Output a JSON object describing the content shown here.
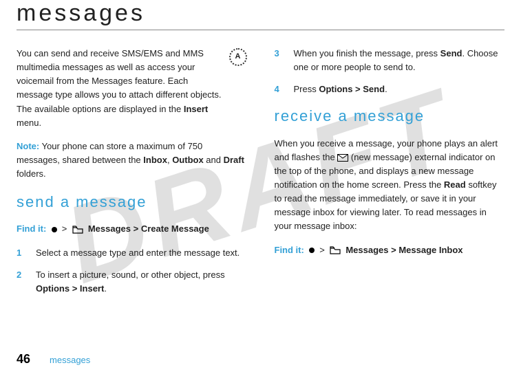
{
  "watermark": "DRAFT",
  "title": "messages",
  "intro": {
    "text_before_bold": "You can send and receive SMS/EMS and MMS multimedia messages as well as access your voicemail from the Messages feature. Each message type allows you to attach different objects. The available options are displayed in the ",
    "bold1": "Insert",
    "text_after_bold1": " menu.",
    "icon_label": "A"
  },
  "note": {
    "label": "Note:",
    "before1": " Your phone can store a maximum of 750 messages, shared between the ",
    "b1": "Inbox",
    "mid1": ", ",
    "b2": "Outbox",
    "mid2": " and ",
    "b3": "Draft",
    "after": " folders."
  },
  "send_section": {
    "heading": "send a message",
    "findit_label": "Find it:",
    "path_messages": "Messages",
    "path_sep": " > ",
    "path_create": "Create Message",
    "step1": {
      "num": "1",
      "text": "Select a message type and enter the message text."
    },
    "step2": {
      "num": "2",
      "before": "To insert a picture, sound, or other object, press ",
      "bold": "Options > Insert",
      "after": "."
    },
    "step3": {
      "num": "3",
      "before": "When you finish the message, press ",
      "bold": "Send",
      "after": ". Choose one or more people to send to."
    },
    "step4": {
      "num": "4",
      "before": "Press ",
      "bold": "Options > Send",
      "after": "."
    }
  },
  "receive_section": {
    "heading": "receive a message",
    "para_before": "When you receive a message, your phone plays an alert and flashes the ",
    "para_mid": " (new message) external indicator on the top of the phone, and displays a new message notification on the home screen. Press the ",
    "para_bold_read": "Read",
    "para_after_read": " softkey to read the message immediately, or save it in your message inbox for viewing later. To read messages in your message inbox:",
    "findit_label": "Find it:",
    "path_messages": "Messages",
    "path_sep": " > ",
    "path_inbox": "Message Inbox"
  },
  "footer": {
    "page_number": "46",
    "tag": "messages"
  }
}
